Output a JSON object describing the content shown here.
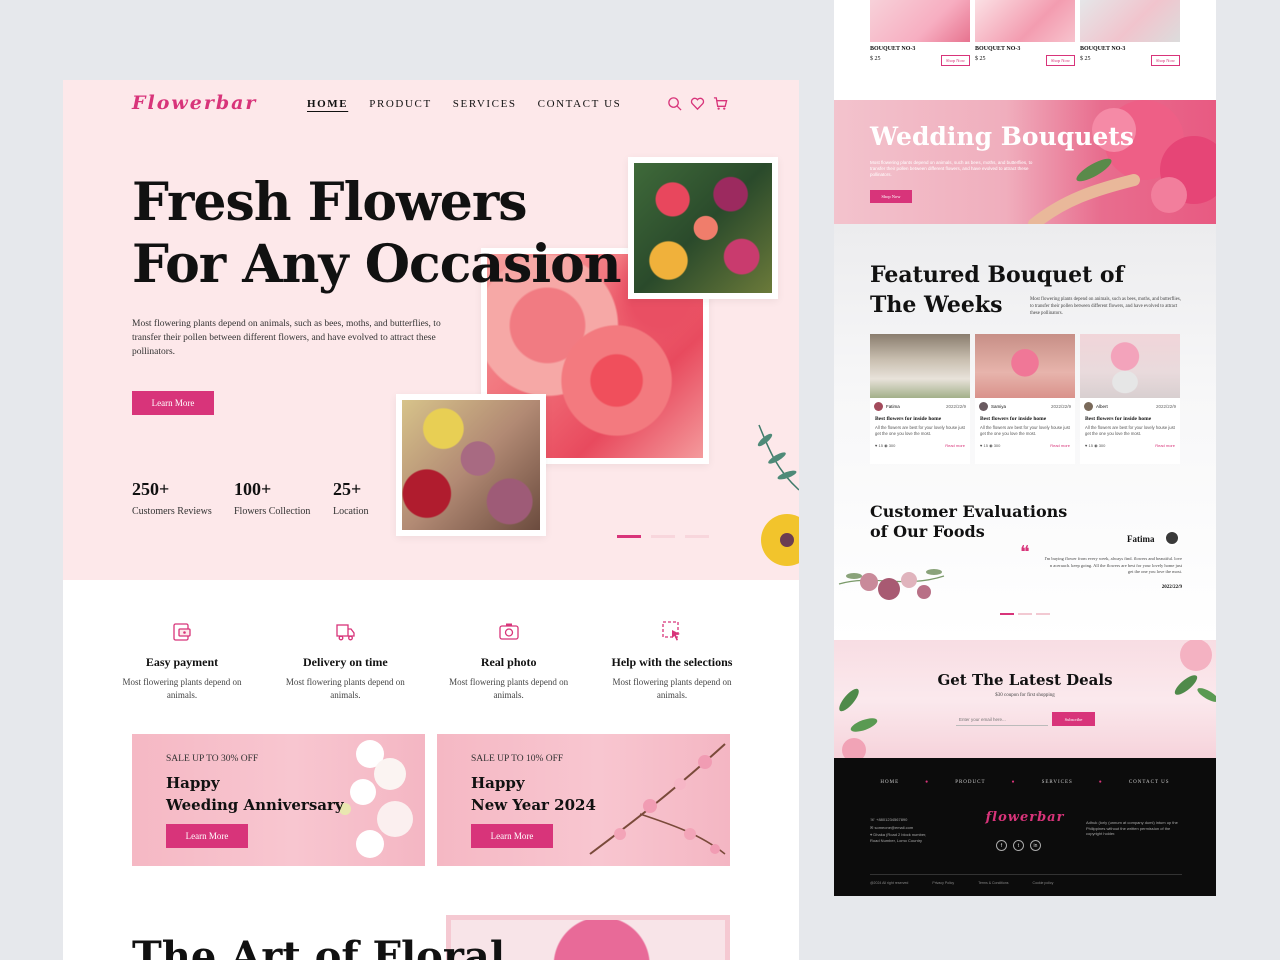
{
  "logo": "Flowerbar",
  "nav": {
    "items": [
      "HOME",
      "PRODUCT",
      "SERVICES",
      "CONTACT US"
    ],
    "active": "HOME"
  },
  "hero": {
    "title_line1": "Fresh Flowers",
    "title_line2": "For Any Occasion",
    "description": "Most flowering plants depend on animals, such as bees, moths, and butterflies, to transfer their pollen between different flowers, and have evolved to attract these pollinators.",
    "button": "Learn More",
    "stats": [
      {
        "value": "250+",
        "label": "Customers Reviews"
      },
      {
        "value": "100+",
        "label": "Flowers Collection"
      },
      {
        "value": "25+",
        "label": "Location"
      }
    ]
  },
  "features": [
    {
      "title": "Easy payment",
      "desc": "Most flowering plants depend on animals.",
      "icon": "payment-icon"
    },
    {
      "title": "Delivery on time",
      "desc": "Most flowering plants depend on animals.",
      "icon": "delivery-truck-icon"
    },
    {
      "title": "Real photo",
      "desc": "Most flowering plants depend on animals.",
      "icon": "camera-icon"
    },
    {
      "title": "Help with the selections",
      "desc": "Most flowering plants depend on animals.",
      "icon": "selection-cursor-icon"
    }
  ],
  "promos": [
    {
      "sale": "SALE UP TO 30% OFF",
      "title_line1": "Happy",
      "title_line2": "Weeding Anniversary",
      "button": "Learn More"
    },
    {
      "sale": "SALE UP TO 10% OFF",
      "title_line1": "Happy",
      "title_line2": "New Year 2024",
      "button": "Learn More"
    }
  ],
  "art_title": "The Art of Floral",
  "products": [
    {
      "name": "BOUQUET NO-3",
      "price": "$ 25",
      "button": "Shop Now"
    },
    {
      "name": "BOUQUET NO-3",
      "price": "$ 25",
      "button": "Shop Now"
    },
    {
      "name": "BOUQUET NO-3",
      "price": "$ 25",
      "button": "Shop Now"
    }
  ],
  "wedding": {
    "title": "Wedding Bouquets",
    "desc": "Most flowering plants depend on animals, such as bees, moths, and butterflies, to transfer their pollen between different flowers, and have evolved to attract these pollinators.",
    "button": "Shop Now"
  },
  "featured": {
    "title_line1": "Featured Bouquet of",
    "title_line2": "The Weeks",
    "desc": "Most flowering plants depend on animals, such as bees, moths, and butterflies, to transfer their pollen between different flowers, and have evolved to attract these pollinators.",
    "cards": [
      {
        "author": "Fatima",
        "date": "2022/22/9",
        "title": "Best flowers for inside home",
        "desc": "All the flowers are best for your lovely house just get the one you love the most.",
        "likes": "15",
        "views": "300",
        "read": "Read more"
      },
      {
        "author": "Samiya",
        "date": "2022/22/9",
        "title": "Best flowers for inside home",
        "desc": "All the flowers are best for your lovely house just get the one you love the most.",
        "likes": "15",
        "views": "300",
        "read": "Read more"
      },
      {
        "author": "Albert",
        "date": "2022/22/9",
        "title": "Best flowers for inside home",
        "desc": "All the flowers are best for your lovely house just get the one you love the most.",
        "likes": "15",
        "views": "300",
        "read": "Read more"
      }
    ]
  },
  "testimonial": {
    "title_line1": "Customer Evaluations",
    "title_line2": "of Our Foods",
    "name": "Fatima",
    "text": "I'm buying flower from every week, always find. flowers and beautiful. love n aceraach. keep going. All the flowers are best for your lovely home just get the one you love the most.",
    "date": "2022/22/9"
  },
  "deals": {
    "title": "Get The Latest Deals",
    "subtitle": "$30 coupon for first shopping",
    "placeholder": "Enter your email here...",
    "button": "Subscribe"
  },
  "footer": {
    "nav": [
      "HOME",
      "PRODUCT",
      "SERVICES",
      "CONTACT US"
    ],
    "logo": "flowerbar",
    "phone": "+8801234567890",
    "email": "someone@email.com",
    "address": "Dhaka (Road 2 block number, Road Number, Lomo Country",
    "about": "Adhuk (lorly (unnum at company dumi) intum up the Philippines without the written permission of the copyright holder.",
    "social": [
      "f",
      "t",
      "in"
    ],
    "bottom": [
      "@2024 All right reserved",
      "Privacy Policy",
      "Terms & Conditions",
      "Cookie policy"
    ]
  },
  "colors": {
    "accent": "#d8347a",
    "hero_bg": "#fde8ea",
    "footer_bg": "#0c0c0c"
  }
}
